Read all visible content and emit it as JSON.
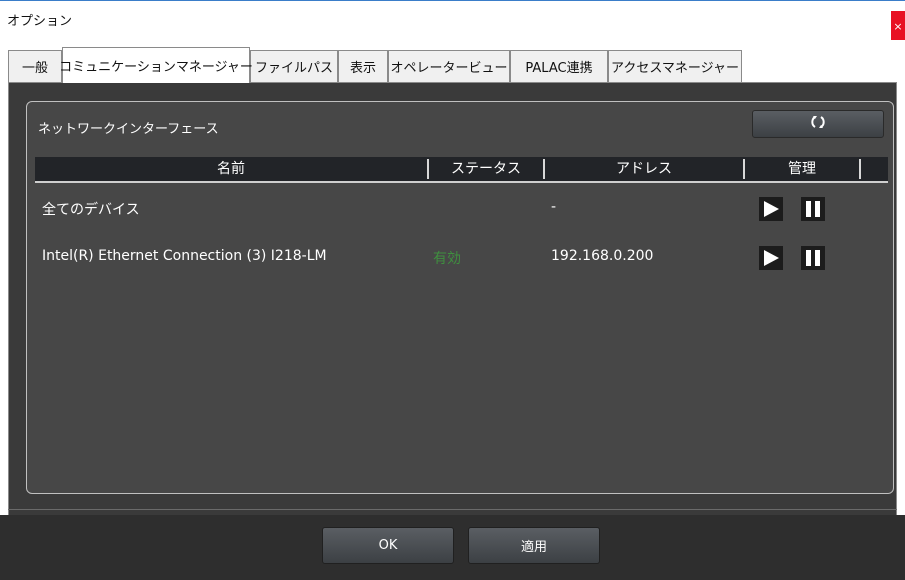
{
  "window": {
    "title": "オプション",
    "close_label": "×"
  },
  "tabs": [
    {
      "label": "一般"
    },
    {
      "label": "コミュニケーションマネージャー"
    },
    {
      "label": "ファイルパス"
    },
    {
      "label": "表示"
    },
    {
      "label": "オペレータービュー"
    },
    {
      "label": "PALAC連携"
    },
    {
      "label": "アクセスマネージャー"
    }
  ],
  "active_tab": "コミュニケーションマネージャー",
  "panel": {
    "title": "ネットワークインターフェース",
    "refresh_icon": "refresh-icon"
  },
  "table": {
    "columns": [
      "名前",
      "ステータス",
      "アドレス",
      "管理"
    ],
    "rows": [
      {
        "name": "全てのデバイス",
        "status": "",
        "address": "-"
      },
      {
        "name": "Intel(R) Ethernet Connection (3) I218-LM",
        "status": "有効",
        "address": "192.168.0.200"
      }
    ]
  },
  "footer": {
    "ok_label": "OK",
    "apply_label": "適用"
  },
  "colors": {
    "content_bg": "#3a3a3a",
    "panel_bg": "#474747",
    "header_bg": "#222428",
    "status_enabled": "#3f8f3f"
  }
}
